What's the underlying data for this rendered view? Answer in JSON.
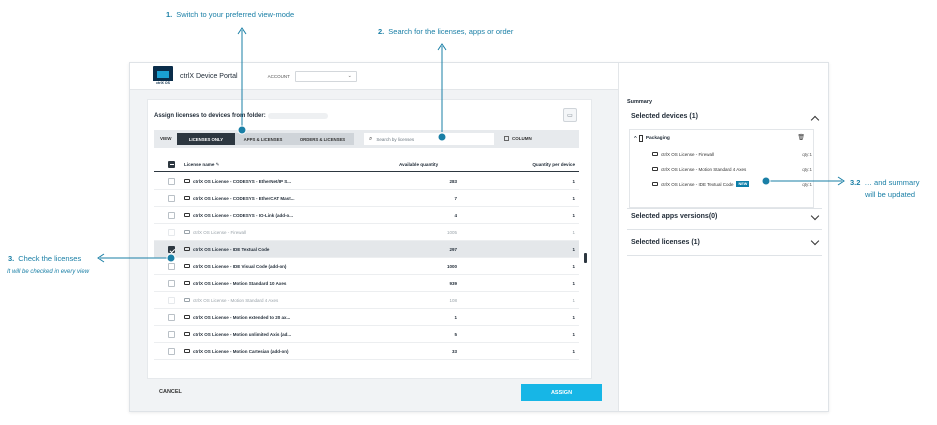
{
  "annotations": {
    "step1": {
      "num": "1.",
      "text": "Switch to your preferred view-mode"
    },
    "step2": {
      "num": "2.",
      "text": "Search for the licenses, apps or order"
    },
    "step3": {
      "num": "3.",
      "text": "Check the licenses",
      "sub": "It will be checked in every view"
    },
    "step32": {
      "num": "3.2",
      "text": "… and summary",
      "text2": "will be updated"
    }
  },
  "colors": {
    "accent": "#1a7fa6",
    "assign": "#17b6e6",
    "dark": "#2d3740"
  },
  "header": {
    "logo_text": "ctrlX OS",
    "app_title": "ctrlX Device Portal",
    "account_label": "ACCOUNT",
    "user_icon": "user-alert-icon"
  },
  "main": {
    "title": "Assign licenses to devices from folder:",
    "view_label": "VIEW",
    "view_modes": [
      "LICENSES ONLY",
      "APPS & LICENSES",
      "ORDERS & LICENSES"
    ],
    "active_view": "LICENSES ONLY",
    "search_placeholder": "Search by licenses",
    "column_label": "COLUMN",
    "columns": {
      "name": "License name",
      "available": "Available quantity",
      "per_device": "Quantity per device"
    },
    "rows": [
      {
        "name": "ctrlX OS License - CODESYS - EtherNet/IP S...",
        "available": "283",
        "qty": "1",
        "state": "normal"
      },
      {
        "name": "ctrlX OS License - CODESYS - EtherCAT Mast...",
        "available": "7",
        "qty": "1",
        "state": "normal"
      },
      {
        "name": "ctrlX OS License - CODESYS - IO-Link (add-o...",
        "available": "4",
        "qty": "1",
        "state": "normal"
      },
      {
        "name": "ctrlX OS License - Firewall",
        "available": "1005",
        "qty": "1",
        "state": "dim"
      },
      {
        "name": "ctrlX OS License - IDE Textual Code",
        "available": "297",
        "qty": "1",
        "state": "checked"
      },
      {
        "name": "ctrlX OS License - IDE Visual Code (add-on)",
        "available": "1000",
        "qty": "1",
        "state": "normal"
      },
      {
        "name": "ctrlX OS License - Motion Standard 10 Axes",
        "available": "939",
        "qty": "1",
        "state": "normal"
      },
      {
        "name": "ctrlX OS License - Motion Standard 4 Axes",
        "available": "108",
        "qty": "1",
        "state": "dim"
      },
      {
        "name": "ctrlX OS License - Motion extended to 20 ax...",
        "available": "1",
        "qty": "1",
        "state": "normal"
      },
      {
        "name": "ctrlX OS License - Motion unlimited Axis (ad...",
        "available": "5",
        "qty": "1",
        "state": "normal"
      },
      {
        "name": "ctrlX OS License - Motion Cartesian (add-on)",
        "available": "33",
        "qty": "1",
        "state": "normal"
      }
    ],
    "cancel_label": "CANCEL",
    "assign_label": "ASSIGN"
  },
  "summary": {
    "title": "Summary",
    "selected_devices": "Selected devices (1)",
    "device_name": "Packaging",
    "device_licenses": [
      {
        "name": "ctrlX OS License - Firewall",
        "qty": "qty:1"
      },
      {
        "name": "ctrlX OS License - Motion Standard 4 Axes",
        "qty": "qty:1"
      },
      {
        "name": "ctrlX OS License - IDE Textual Code",
        "qty": "qty:1",
        "badge": "NEW"
      }
    ],
    "selected_apps": "Selected apps versions(0)",
    "selected_licenses": "Selected licenses (1)"
  }
}
